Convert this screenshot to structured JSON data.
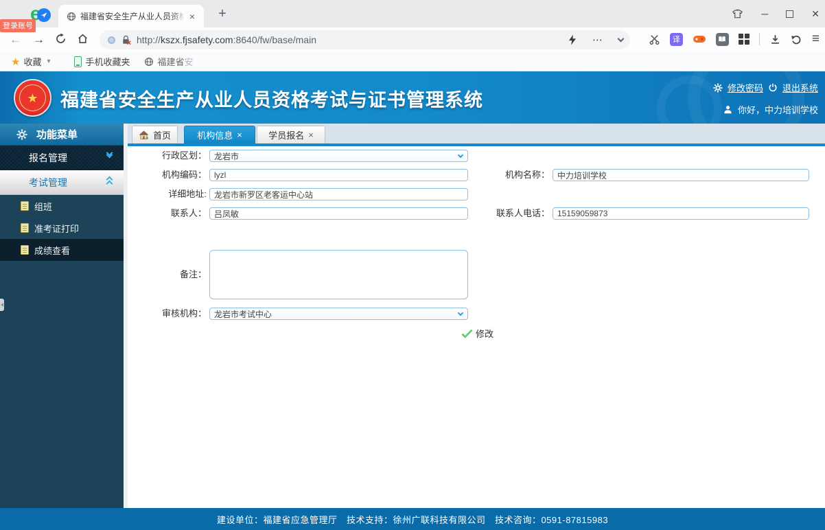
{
  "icons": {
    "close": "×",
    "plus": "+",
    "minimize": "─",
    "window_close": "✕",
    "ellipsis": "⋯",
    "caret_down": "▾",
    "star": "★",
    "menu": "≡",
    "translate_badge": "译",
    "browser_logo": "e",
    "back_arrow": "←",
    "forward_arrow": "→",
    "emblem_star": "★"
  },
  "browser": {
    "login_badge": "登录账号",
    "tab_title": "福建省安全生产从业人员资格考",
    "url": {
      "scheme": "http://",
      "host": "kszx.fjsafety.com",
      "path": ":8640/fw/base/main"
    },
    "bookmarks": {
      "favorites": "收藏",
      "mobile_folder": "手机收藏夹",
      "site": "福建省",
      "site_faded": "安"
    }
  },
  "header": {
    "system_title": "福建省安全生产从业人员资格考试与证书管理系统",
    "change_password": "修改密码",
    "logout": "退出系统",
    "greeting": "你好，中力培训学校"
  },
  "sidebar": {
    "menu_title": "功能菜单",
    "group_enroll": "报名管理",
    "group_exam": "考试管理",
    "items": [
      {
        "label": "组班"
      },
      {
        "label": "准考证打印"
      },
      {
        "label": "成绩查看"
      }
    ]
  },
  "tabs": [
    {
      "label": "首页"
    },
    {
      "label": "机构信息"
    },
    {
      "label": "学员报名"
    }
  ],
  "form": {
    "region_label": "行政区划：",
    "region_value": "龙岩市",
    "org_code_label": "机构编码：",
    "org_code_value": "lyzl",
    "org_name_label": "机构名称：",
    "org_name_value": "中力培训学校",
    "address_label": "详细地址:",
    "address_value": "龙岩市新罗区老客运中心站",
    "contact_label": "联系人：",
    "contact_value": "吕凤敏",
    "phone_label": "联系人电话：",
    "phone_value": "15159059873",
    "remark_label": "备注：",
    "remark_value": "",
    "audit_label": "审核机构：",
    "audit_value": "龙岩市考试中心",
    "submit_label": "修改"
  },
  "footer": {
    "text": "建设单位：福建省应急管理厅　技术支持：徐州广联科技有限公司　技术咨询：0591-87815983"
  },
  "colors": {
    "accent_blue": "#1389cb",
    "header_blue": "#1590ce",
    "sidebar_teal": "#1c4357",
    "footer_blue": "#0a6ba9",
    "active_tab_blue": "#1590d2",
    "badge_red": "#f8715f"
  }
}
